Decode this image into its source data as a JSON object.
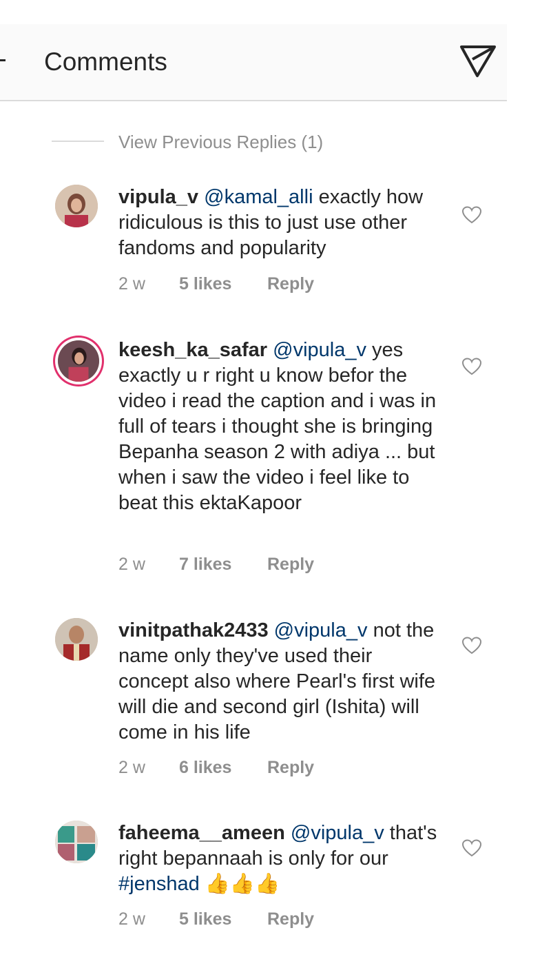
{
  "header": {
    "title": "Comments"
  },
  "view_previous": "View Previous Replies (1)",
  "comments": [
    {
      "username": "vipula_v",
      "mention": "@kamal_alli",
      "text": " exactly how ridiculous is this to just use other fandoms and popularity",
      "tail": "",
      "emoji": "",
      "time": "2 w",
      "likes": "5 likes",
      "reply": "Reply"
    },
    {
      "username": "keesh_ka_safar",
      "mention": "@vipula_v",
      "text": " yes exactly u r right u know befor the video i read the caption and i was in full of tears i thought she is bringing Bepanha season 2 with adiya ... but when i saw the video i feel like to beat this ektaKapoor",
      "tail": "",
      "emoji": "",
      "time": "2 w",
      "likes": "7 likes",
      "reply": "Reply"
    },
    {
      "username": "vinitpathak2433",
      "mention": "@vipula_v",
      "text": " not the name only they've used their concept also where Pearl's first wife will die and second girl (Ishita) will come in his life",
      "tail": "",
      "emoji": "",
      "time": "2 w",
      "likes": "6 likes",
      "reply": "Reply"
    },
    {
      "username": "faheema__ameen",
      "mention": "@vipula_v",
      "text": " that's right bepannaah is only for our ",
      "tail": "#jenshad",
      "emoji": " 👍👍👍",
      "time": "2 w",
      "likes": "5 likes",
      "reply": "Reply"
    }
  ],
  "icons": {
    "share": "send-icon",
    "like": "heart-icon",
    "back": "back-arrow-icon"
  },
  "colors": {
    "mention": "#00376b",
    "meta": "#8e8e8e",
    "story_ring": "#e1306c"
  }
}
